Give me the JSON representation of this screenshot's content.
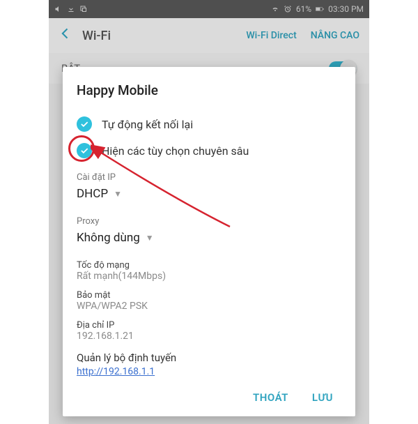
{
  "statusbar": {
    "battery": "61%",
    "time": "03:30 PM"
  },
  "header": {
    "title": "Wi-Fi",
    "direct": "Wi-Fi Direct",
    "advanced": "NÂNG CAO"
  },
  "toggle_label": "BẬT",
  "dialog": {
    "title": "Happy Mobile",
    "auto_reconnect": "Tự động kết nối lại",
    "show_advanced": "Hiện các tùy chọn chuyên sâu",
    "ip_settings_label": "Cài đặt IP",
    "ip_settings_value": "DHCP",
    "proxy_label": "Proxy",
    "proxy_value": "Không dùng",
    "speed_label": "Tốc độ mạng",
    "speed_value": "Rất mạnh(144Mbps)",
    "security_label": "Bảo mật",
    "security_value": "WPA/WPA2 PSK",
    "ip_label": "Địa chỉ IP",
    "ip_value": "192.168.1.21",
    "router_label": "Quản lý bộ định tuyến",
    "router_link": "http://192.168.1.1",
    "cancel": "THOÁT",
    "save": "LƯU"
  }
}
